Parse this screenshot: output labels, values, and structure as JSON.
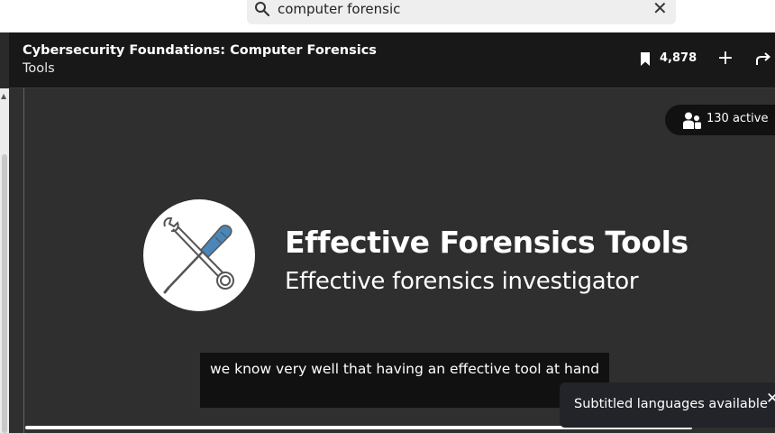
{
  "search": {
    "value": "computer forensic",
    "icon": "search-icon",
    "clear_icon": "close-icon"
  },
  "player": {
    "course_title": "Cybersecurity Foundations: Computer Forensics",
    "section_title": "Tools",
    "saves_count": "4,878",
    "active_label": "130 active",
    "slide": {
      "title": "Effective Forensics Tools",
      "subtitle": "Effective forensics investigator"
    },
    "caption": "we know very well that having an effective tool at hand",
    "toast": "Subtitled languages available"
  },
  "colors": {
    "player_bg": "#2f2f2f",
    "topbar_bg": "#181818",
    "logo_accent": "#4a86b8"
  }
}
